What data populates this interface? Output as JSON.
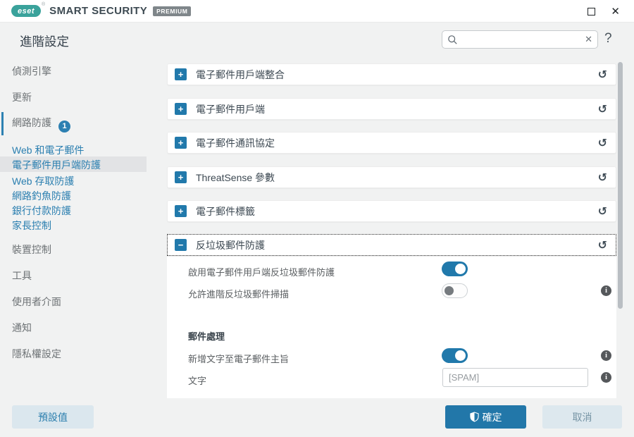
{
  "titlebar": {
    "logo": "eset",
    "reg": "®",
    "brand": "SMART SECURITY",
    "premium": "PREMIUM"
  },
  "header": {
    "title": "進階設定",
    "help_label": "?",
    "search_value": ""
  },
  "icons": {
    "plus": "+",
    "minus": "−",
    "undo": "↺",
    "close": "✕",
    "clear": "✕",
    "info": "i"
  },
  "sidebar": {
    "items": [
      {
        "label": "偵測引擎"
      },
      {
        "label": "更新"
      },
      {
        "label": "網路防護",
        "badge": "1"
      },
      {
        "label": "Web 和電子郵件"
      },
      {
        "label": "電子郵件用戶端防護",
        "selected": true
      },
      {
        "label": "Web 存取防護"
      },
      {
        "label": "網路釣魚防護"
      },
      {
        "label": "銀行付款防護"
      },
      {
        "label": "家長控制"
      },
      {
        "label": "裝置控制"
      },
      {
        "label": "工具"
      },
      {
        "label": "使用者介面"
      },
      {
        "label": "通知"
      },
      {
        "label": "隱私權設定"
      }
    ]
  },
  "sections": [
    {
      "label": "電子郵件用戶端整合",
      "state": "collapsed"
    },
    {
      "label": "電子郵件用戶端",
      "state": "collapsed"
    },
    {
      "label": "電子郵件通訊協定",
      "state": "collapsed"
    },
    {
      "label": "ThreatSense 參數",
      "state": "collapsed"
    },
    {
      "label": "電子郵件標籤",
      "state": "collapsed"
    },
    {
      "label": "反垃圾郵件防護",
      "state": "expanded"
    }
  ],
  "panel": {
    "heading": "郵件處理",
    "rows": [
      {
        "label": "啟用電子郵件用戶端反垃圾郵件防護",
        "type": "toggle",
        "state": "on"
      },
      {
        "label": "允許進階反垃圾郵件掃描",
        "type": "toggle",
        "state": "off",
        "info": true
      },
      {
        "label": "新增文字至電子郵件主旨",
        "type": "toggle",
        "state": "on",
        "info": true
      },
      {
        "label": "文字",
        "type": "input",
        "value": "[SPAM]",
        "info": true
      }
    ]
  },
  "footer": {
    "default_label": "預設值",
    "ok_label": "確定",
    "cancel_label": "取消"
  },
  "colors": {
    "accent_blue": "#2179ab",
    "sidebar_link": "#2b7fb0",
    "logo_teal": "#3aa29b",
    "body_bg": "#f1f2f2",
    "toggle_off_knob": "#767b7f"
  }
}
